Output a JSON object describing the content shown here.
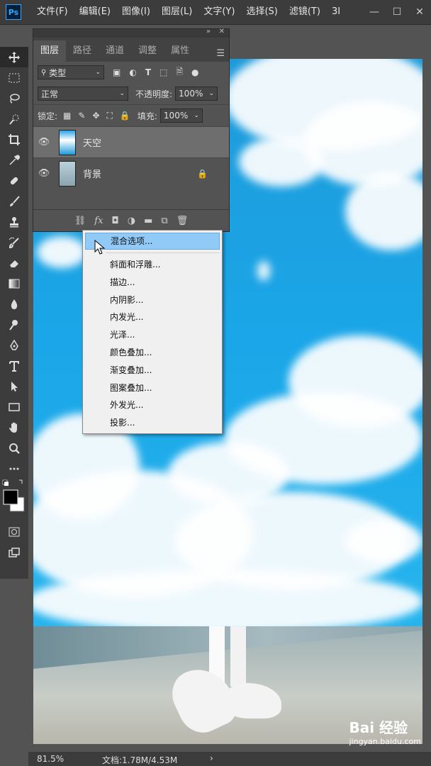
{
  "app": {
    "logo": "Ps",
    "menu": [
      "文件(F)",
      "编辑(E)",
      "图像(I)",
      "图层(L)",
      "文字(Y)",
      "选择(S)",
      "滤镜(T)",
      "3I"
    ],
    "window_controls": [
      "—",
      "☐",
      "✕"
    ]
  },
  "layers_panel": {
    "tabs": [
      "图层",
      "路径",
      "通道",
      "调整",
      "属性"
    ],
    "filter_select": "类型",
    "blend_mode": "正常",
    "opacity_label": "不透明度:",
    "opacity_value": "100%",
    "lock_label": "锁定:",
    "fill_label": "填充:",
    "fill_value": "100%",
    "layers": [
      {
        "name": "天空",
        "selected": true
      },
      {
        "name": "背景",
        "selected": false,
        "locked": true
      }
    ],
    "bottom_icons": [
      "link-icon",
      "fx-icon",
      "mask-icon",
      "adjustment-icon",
      "folder-icon",
      "new-layer-icon",
      "trash-icon"
    ],
    "fx_label": "fx"
  },
  "context_menu": {
    "items": [
      "混合选项...",
      "斜面和浮雕...",
      "描边...",
      "内阴影...",
      "内发光...",
      "光泽...",
      "颜色叠加...",
      "渐变叠加...",
      "图案叠加...",
      "外发光...",
      "投影..."
    ],
    "highlighted_index": 0
  },
  "status": {
    "zoom": "81.5%",
    "doc": "文档:1.78M/4.53M"
  },
  "watermark": {
    "brand": "Bai 经验",
    "url": "jingyan.baidu.com"
  },
  "colors": {
    "ui_dark": "#3c3c3c",
    "panel": "#535353",
    "highlight": "#91c9f7",
    "sky": "#1aa6e8"
  }
}
